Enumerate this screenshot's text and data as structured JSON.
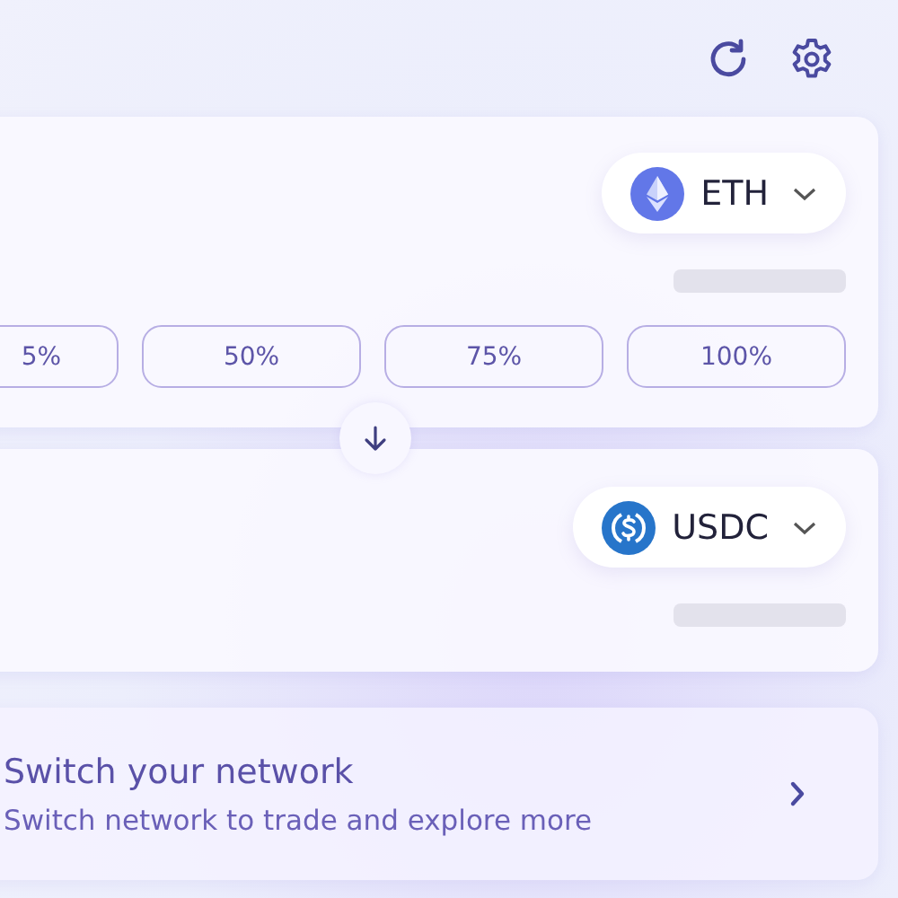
{
  "from_card": {
    "token": {
      "kind": "eth",
      "symbol": "ETH"
    },
    "percent_buttons": [
      "5%",
      "50%",
      "75%",
      "100%"
    ]
  },
  "to_card": {
    "token": {
      "kind": "usdc",
      "symbol": "USDC"
    }
  },
  "network_banner": {
    "title": "Switch your network",
    "subtitle": "Switch network to trade and explore more"
  }
}
